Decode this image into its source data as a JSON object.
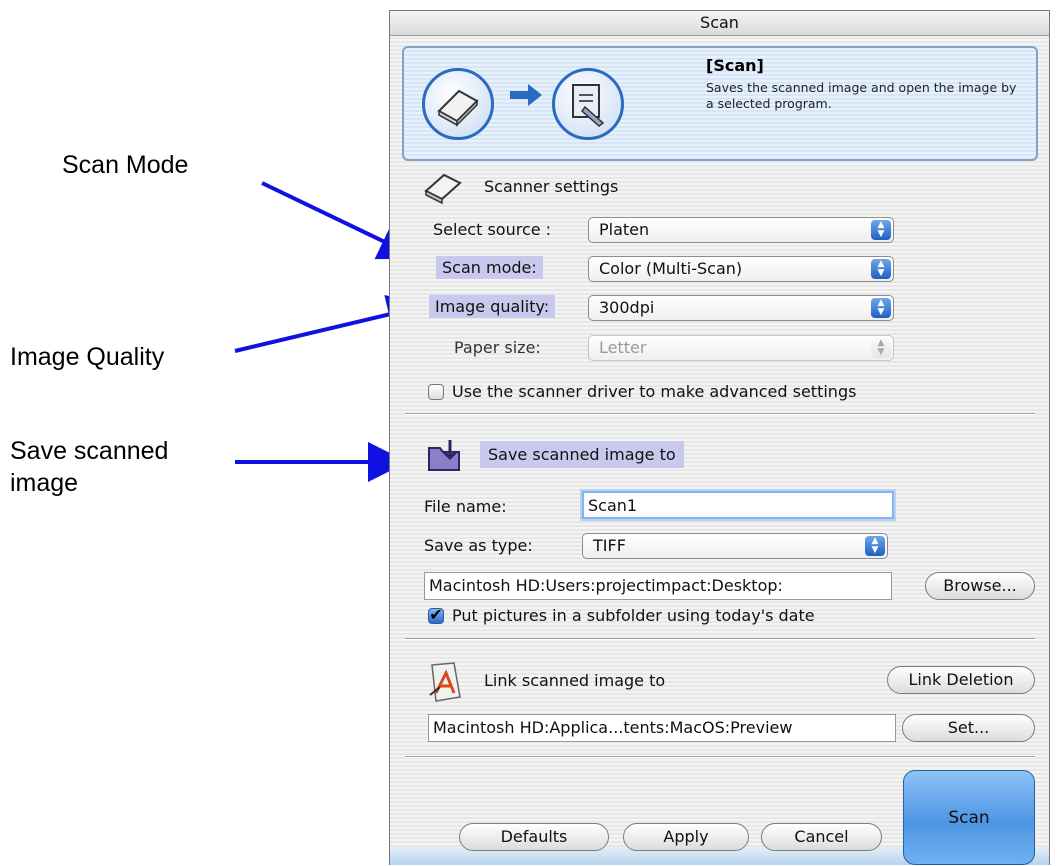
{
  "annotations": {
    "scan_mode": "Scan  Mode",
    "image_quality": "Image Quality",
    "save_line1": "Save scanned",
    "save_line2": "image"
  },
  "window": {
    "title": "Scan"
  },
  "banner": {
    "title": "[Scan]",
    "description": "Saves the scanned image and open the image by a selected program.",
    "icons": [
      "scanner-icon",
      "arrow-right-icon",
      "open-program-icon"
    ]
  },
  "scanner_settings": {
    "heading": "Scanner settings",
    "select_source_label": "Select source :",
    "select_source_value": "Platen",
    "scan_mode_label": "Scan mode:",
    "scan_mode_value": "Color (Multi-Scan)",
    "image_quality_label": "Image quality:",
    "image_quality_value": "300dpi",
    "paper_size_label": "Paper size:",
    "paper_size_value": "Letter",
    "advanced_checkbox_label": "Use the scanner driver to make advanced settings",
    "advanced_checked": false
  },
  "save": {
    "heading": "Save scanned image to",
    "file_name_label": "File name:",
    "file_name_value": "Scan1",
    "save_type_label": "Save as type:",
    "save_type_value": "TIFF",
    "path": "Macintosh HD:Users:projectimpact:Desktop:",
    "browse_label": "Browse...",
    "subfolder_label": "Put pictures in a subfolder using today's date",
    "subfolder_checked": true
  },
  "link": {
    "heading": "Link scanned image to",
    "link_deletion_label": "Link Deletion",
    "path": "Macintosh HD:Applica...tents:MacOS:Preview",
    "set_label": "Set..."
  },
  "buttons": {
    "defaults": "Defaults",
    "apply": "Apply",
    "cancel": "Cancel",
    "scan": "Scan"
  },
  "colors": {
    "arrow": "#1010e0",
    "highlight": "#c9c9ee",
    "scan_button": "#4e95e3"
  }
}
